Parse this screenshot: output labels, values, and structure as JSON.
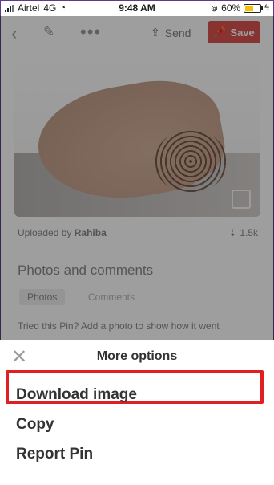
{
  "status_bar": {
    "carrier": "Airtel",
    "network": "4G",
    "time": "9:48 AM",
    "battery": "60%",
    "battery_level": 0.6
  },
  "toolbar": {
    "back_icon": "chevron-left-icon",
    "edit_icon": "pencil-icon",
    "more_icon": "more-icon",
    "send_label": "Send",
    "save_label": "Save"
  },
  "pin": {
    "uploaded_prefix": "Uploaded by",
    "uploader": "Rahiba",
    "saves_count": "1.5k"
  },
  "comments_section": {
    "heading": "Photos and comments",
    "tabs": [
      "Photos",
      "Comments"
    ],
    "prompt": "Tried this Pin? Add a photo to show how it went"
  },
  "sheet": {
    "title": "More options",
    "options": [
      "Download image",
      "Copy",
      "Report Pin"
    ]
  },
  "colors": {
    "accent": "#d9534f",
    "highlight": "#e02020"
  }
}
